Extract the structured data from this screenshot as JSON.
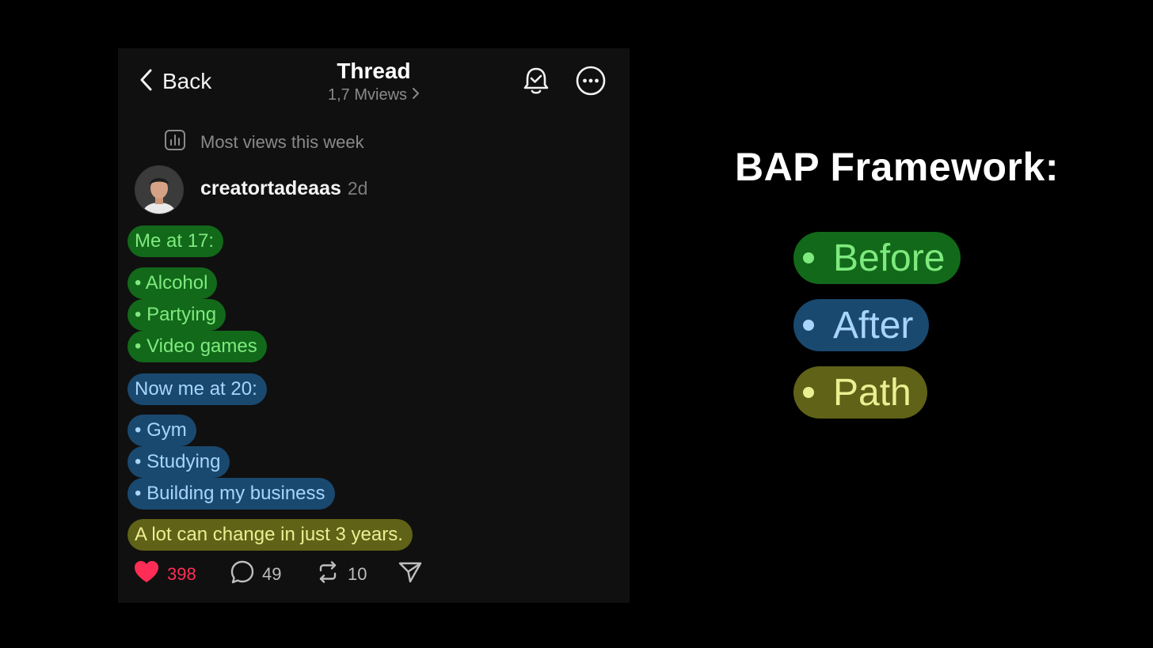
{
  "header": {
    "back_label": "Back",
    "title": "Thread",
    "views": "1,7 Mviews"
  },
  "highlight": {
    "label": "Most views this week"
  },
  "post": {
    "author": "creatortadeaas",
    "time": "2d",
    "lines": {
      "before_title": "Me at 17:",
      "before_items": [
        "• Alcohol",
        "• Partying",
        "• Video games"
      ],
      "after_title": "Now me at 20:",
      "after_items": [
        "• Gym",
        "• Studying",
        "• Building my business"
      ],
      "path_line": "A lot can change in just 3 years."
    }
  },
  "actions": {
    "likes": "398",
    "replies": "49",
    "reposts": "10"
  },
  "framework": {
    "heading": "BAP Framework:",
    "items": [
      "Before",
      "After",
      "Path"
    ]
  },
  "colors": {
    "before_bg": "#12691a",
    "before_text": "#7eea7e",
    "after_bg": "#1a4970",
    "after_text": "#a7d5fc",
    "path_bg": "#5f6217",
    "path_text": "#ecee92",
    "like": "#ff2d55"
  },
  "icons": [
    "chevron-left-icon",
    "chevron-right-icon",
    "bell-check-icon",
    "more-icon",
    "chart-icon",
    "heart-icon",
    "comment-icon",
    "repost-icon",
    "send-icon"
  ]
}
